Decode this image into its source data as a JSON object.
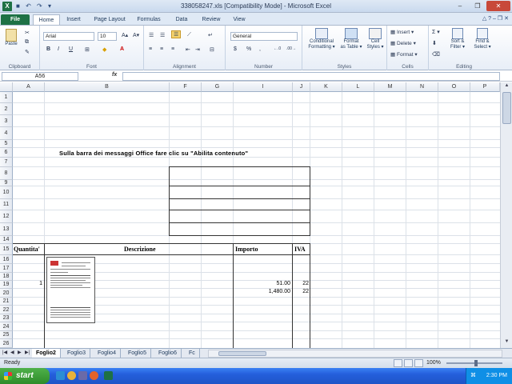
{
  "window": {
    "title": "338058247.xls  [Compatibility Mode]  -  Microsoft Excel",
    "app_badge": "X",
    "controls": {
      "minimize": "–",
      "restore": "❐",
      "close": "✕"
    }
  },
  "ribbon_tabs": [
    "File",
    "Home",
    "Insert",
    "Page Layout",
    "Formulas",
    "Data",
    "Review",
    "View"
  ],
  "active_tab": "Home",
  "ribbon": {
    "clipboard": {
      "label": "Clipboard",
      "paste": "Paste"
    },
    "font": {
      "label": "Font",
      "name": "Arial",
      "size": "10",
      "bold": "B",
      "italic": "I",
      "underline": "U"
    },
    "alignment": {
      "label": "Alignment"
    },
    "number": {
      "label": "Number",
      "format": "General",
      "currency": "$",
      "percent": "%",
      "comma": ","
    },
    "styles": {
      "label": "Styles",
      "conditional": "Conditional",
      "conditional2": "Formatting ▾",
      "format_as": "Format",
      "format_as2": "as Table ▾",
      "cell": "Cell",
      "cell2": "Styles ▾"
    },
    "cells": {
      "label": "Cells",
      "insert": "Insert ▾",
      "delete": "Delete ▾",
      "format": "Format ▾"
    },
    "editing": {
      "label": "Editing",
      "sigma": "Σ ▾",
      "sort": "Sort &",
      "sort2": "Filter ▾",
      "find": "Find &",
      "find2": "Select ▾"
    }
  },
  "formula_bar": {
    "name_box": "A56",
    "fx": "fx",
    "content": ""
  },
  "columns": [
    "A",
    "B",
    "F",
    "G",
    "I",
    "J",
    "K",
    "L",
    "M",
    "N",
    "O",
    "P"
  ],
  "rows": [
    "1",
    "2",
    "3",
    "4",
    "5",
    "6",
    "7",
    "8",
    "9",
    "10",
    "11",
    "12",
    "13",
    "14",
    "15",
    "16",
    "17",
    "18",
    "19",
    "20",
    "21",
    "22",
    "23",
    "24",
    "25",
    "26"
  ],
  "sheet": {
    "message": "Sulla barra dei messaggi Office fare clic su \"Abilita contenuto\"",
    "headers": {
      "quantity": "Quantita'",
      "description": "Descrizione",
      "amount": "Importo",
      "vat": "IVA"
    },
    "row19": {
      "quantity": "1",
      "amount": "51.00",
      "vat": "22"
    },
    "row20": {
      "amount": "1,480.00",
      "vat": "22"
    }
  },
  "sheet_tabs": [
    "Foglio2",
    "Foglio3",
    "Foglio4",
    "Foglio5",
    "Foglio6",
    "Fc"
  ],
  "active_sheet": "Foglio2",
  "status": {
    "ready": "Ready",
    "zoom": "100%"
  },
  "taskbar": {
    "start": "start",
    "time": "2:30 PM"
  }
}
